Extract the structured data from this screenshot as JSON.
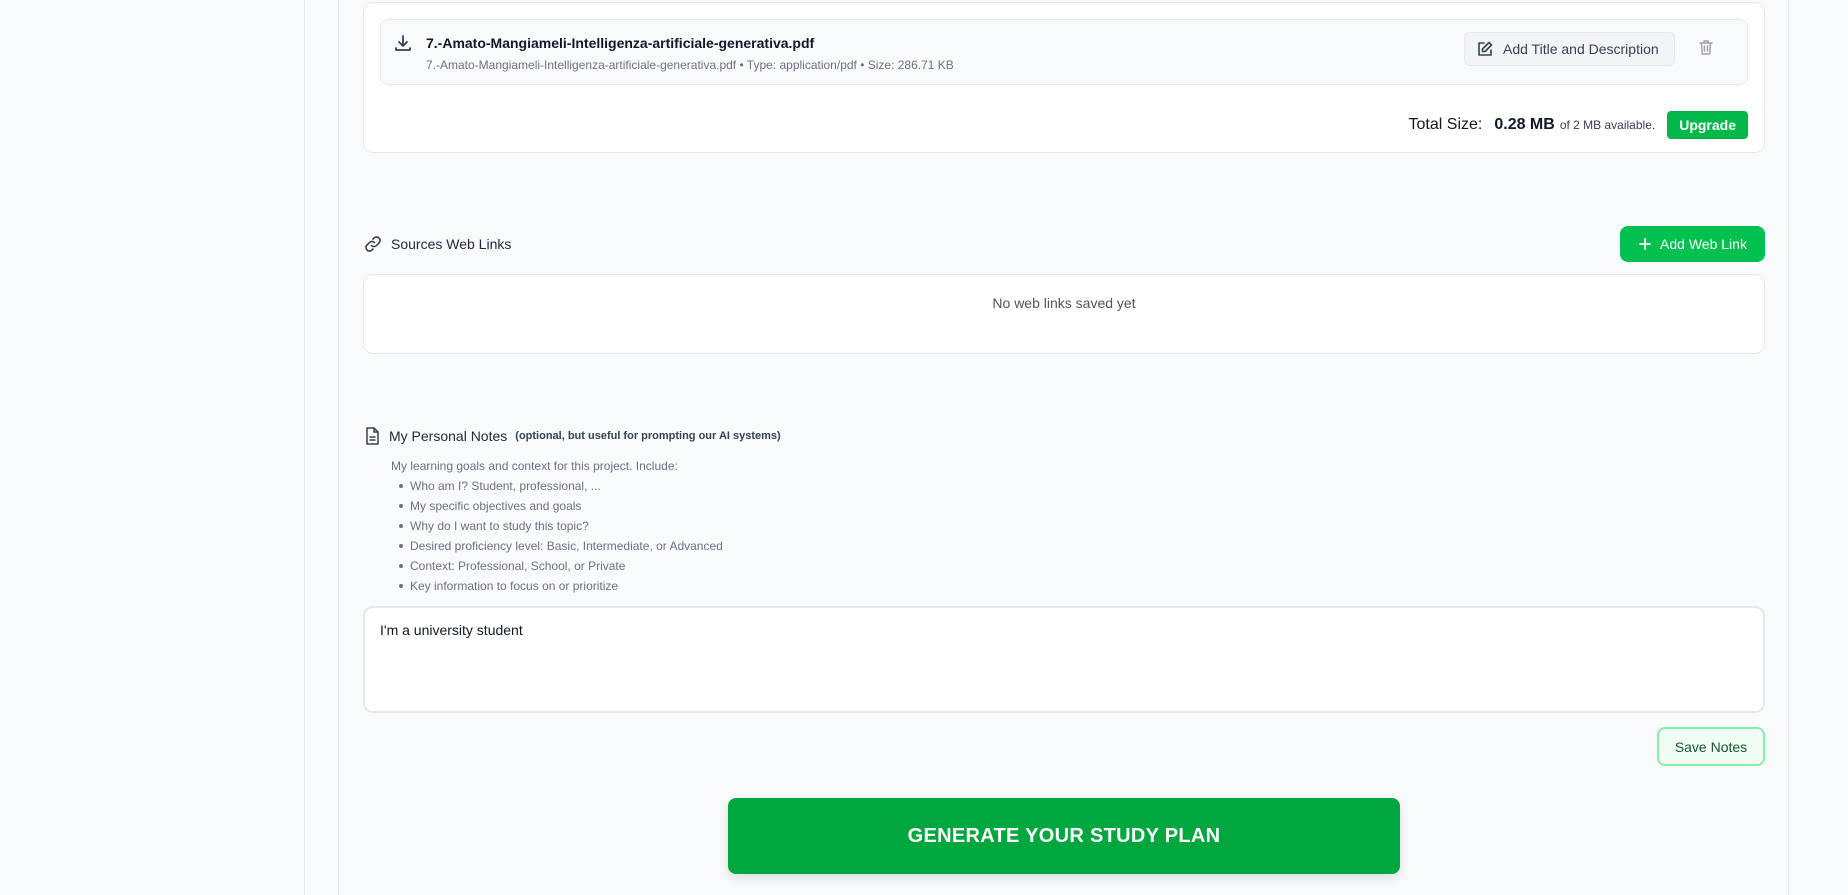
{
  "colors": {
    "accent_green": "#00c050",
    "generate_green": "#00a63e",
    "page_bg": "#f8fafc"
  },
  "files": {
    "items": [
      {
        "name": "7.-Amato-Mangiameli-Intelligenza-artificiale-generativa.pdf",
        "meta": "7.-Amato-Mangiameli-Intelligenza-artificiale-generativa.pdf • Type: application/pdf • Size: 286.71 KB",
        "download_icon": "download-icon",
        "edit_label": "Add Title and Description",
        "edit_icon": "edit-icon",
        "delete_icon": "trash-icon"
      }
    ],
    "total_label": "Total Size:",
    "total_value": "0.28 MB",
    "total_of": "of 2 MB available.",
    "upgrade_label": "Upgrade"
  },
  "web_links": {
    "title": "Sources Web Links",
    "icon": "link-icon",
    "add_label": "Add Web Link",
    "add_icon": "plus-icon",
    "empty_text": "No web links saved yet"
  },
  "notes": {
    "title": "My Personal Notes",
    "subtitle": "(optional, but useful for prompting our AI systems)",
    "icon": "document-icon",
    "intro": "My learning goals and context for this project. Include:",
    "bullets": [
      "Who am I? Student, professional, ...",
      "My specific objectives and goals",
      "Why do I want to study this topic?",
      "Desired proficiency level: Basic, Intermediate, or Advanced",
      "Context: Professional, School, or Private",
      "Key information to focus on or prioritize"
    ],
    "value": "I'm a university student",
    "save_label": "Save Notes"
  },
  "generate_label": "GENERATE YOUR STUDY PLAN"
}
